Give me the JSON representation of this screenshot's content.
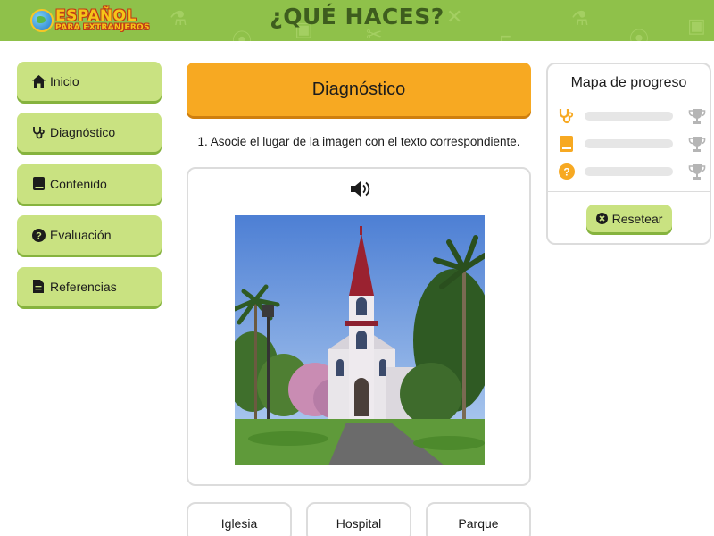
{
  "header": {
    "logo_line1": "ESPAÑOL",
    "logo_line2": "PARA EXTRANJEROS",
    "title": "¿QUÉ HACES?",
    "bg_color": "#8fc14a"
  },
  "nav": {
    "items": [
      {
        "label": "Inicio",
        "icon": "home-icon"
      },
      {
        "label": "Diagnóstico",
        "icon": "stethoscope-icon"
      },
      {
        "label": "Contenido",
        "icon": "book-icon"
      },
      {
        "label": "Evaluación",
        "icon": "question-circle-icon"
      },
      {
        "label": "Referencias",
        "icon": "document-icon"
      }
    ],
    "color": "#c9e281"
  },
  "main": {
    "section_title": "Diagnóstico",
    "section_color": "#f7a922",
    "instruction": "1. Asocie el lugar de la imagen con el texto correspondiente.",
    "audio_icon": "speaker-icon",
    "answers": [
      "Iglesia",
      "Hospital",
      "Parque"
    ]
  },
  "progress": {
    "title": "Mapa de progreso",
    "rows": [
      {
        "icon": "stethoscope-icon",
        "value": 0,
        "trophy": "trophy-icon"
      },
      {
        "icon": "book-icon",
        "value": 0,
        "trophy": "trophy-icon"
      },
      {
        "icon": "question-circle-icon",
        "value": 0,
        "trophy": "trophy-icon"
      }
    ],
    "accent_color": "#f7a922",
    "reset_label": "Resetear"
  }
}
